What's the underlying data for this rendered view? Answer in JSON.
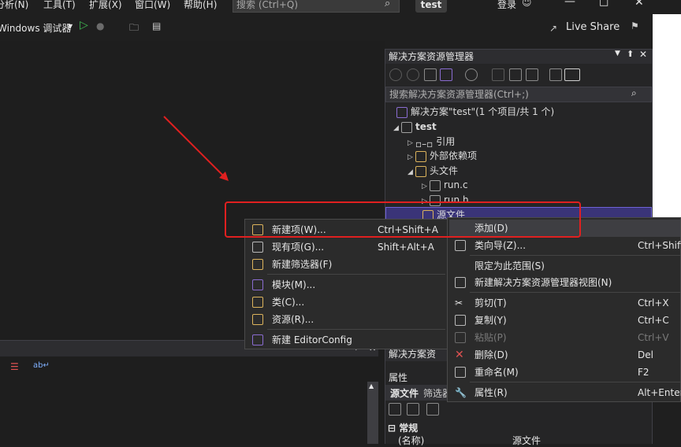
{
  "menubar": {
    "items": [
      "分析(N)",
      "工具(T)",
      "扩展(X)",
      "窗口(W)",
      "帮助(H)"
    ],
    "search_placeholder": "搜索 (Ctrl+Q)",
    "solution_tab": "test",
    "login": "登录"
  },
  "toolbar": {
    "debugger": "Windows 调试器",
    "live_share": "Live Share"
  },
  "solution_explorer": {
    "title": "解决方案资源管理器",
    "search_placeholder": "搜索解决方案资源管理器(Ctrl+;)",
    "tree": {
      "solution": "解决方案\"test\"(1 个项目/共 1 个)",
      "project": "test",
      "references": "引用",
      "external_deps": "外部依赖项",
      "header_files": "头文件",
      "file_c": "run.c",
      "file_h": "run.h",
      "source_files": "源文件"
    }
  },
  "context_menu_add": {
    "items": [
      {
        "label": "新建项(W)...",
        "shortcut": "Ctrl+Shift+A"
      },
      {
        "label": "现有项(G)...",
        "shortcut": "Shift+Alt+A"
      },
      {
        "label": "新建筛选器(F)",
        "shortcut": ""
      },
      {
        "label": "模块(M)...",
        "shortcut": ""
      },
      {
        "label": "类(C)...",
        "shortcut": ""
      },
      {
        "label": "资源(R)...",
        "shortcut": ""
      },
      {
        "label": "新建 EditorConfig",
        "shortcut": ""
      }
    ]
  },
  "context_menu_main": {
    "items": [
      {
        "label": "添加(D)",
        "shortcut": ""
      },
      {
        "label": "类向导(Z)...",
        "shortcut": "Ctrl+Shift"
      },
      {
        "label": "限定为此范围(S)",
        "shortcut": ""
      },
      {
        "label": "新建解决方案资源管理器视图(N)",
        "shortcut": ""
      },
      {
        "label": "剪切(T)",
        "shortcut": "Ctrl+X"
      },
      {
        "label": "复制(Y)",
        "shortcut": "Ctrl+C"
      },
      {
        "label": "粘贴(P)",
        "shortcut": "Ctrl+V"
      },
      {
        "label": "删除(D)",
        "shortcut": "Del"
      },
      {
        "label": "重命名(M)",
        "shortcut": "F2"
      },
      {
        "label": "属性(R)",
        "shortcut": "Alt+Enter"
      }
    ]
  },
  "properties": {
    "tab": "解决方案资",
    "title": "属性",
    "object": "源文件",
    "object_type": "筛选器",
    "section": "常规",
    "row_name": "(名称)",
    "row_value": "源文件"
  },
  "colors": {
    "annotation_red": "#e02020",
    "selection": "#3a3478"
  }
}
